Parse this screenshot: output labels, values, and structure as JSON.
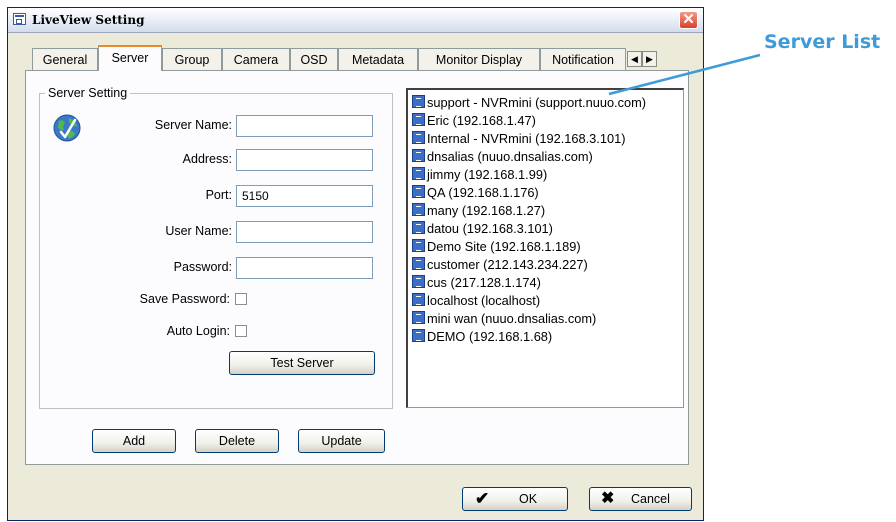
{
  "window": {
    "title": "LiveView Setting"
  },
  "tabs": [
    "General",
    "Server",
    "Group",
    "Camera",
    "OSD",
    "Metadata",
    "Monitor Display",
    "Notification"
  ],
  "server_setting": {
    "legend": "Server Setting",
    "server_name_label": "Server Name:",
    "server_name_value": "",
    "address_label": "Address:",
    "address_value": "",
    "port_label": "Port:",
    "port_value": "5150",
    "user_name_label": "User Name:",
    "user_name_value": "",
    "password_label": "Password:",
    "password_value": "",
    "save_password_label": "Save Password:",
    "save_password_checked": false,
    "auto_login_label": "Auto Login:",
    "auto_login_checked": false,
    "test_server_label": "Test Server"
  },
  "actions": {
    "add_label": "Add",
    "delete_label": "Delete",
    "update_label": "Update"
  },
  "server_list": [
    "support - NVRmini (support.nuuo.com)",
    "Eric (192.168.1.47)",
    "Internal - NVRmini (192.168.3.101)",
    "dnsalias (nuuo.dnsalias.com)",
    "jimmy (192.168.1.99)",
    "QA (192.168.1.176)",
    "many (192.168.1.27)",
    "datou (192.168.3.101)",
    "Demo Site (192.168.1.189)",
    "customer (212.143.234.227)",
    "cus (217.128.1.174)",
    "localhost (localhost)",
    "mini wan (nuuo.dnsalias.com)",
    "DEMO (192.168.1.68)"
  ],
  "dialog_buttons": {
    "ok_label": "OK",
    "cancel_label": "Cancel"
  },
  "annotation": {
    "label": "Server List",
    "color": "#3f9ad8"
  }
}
